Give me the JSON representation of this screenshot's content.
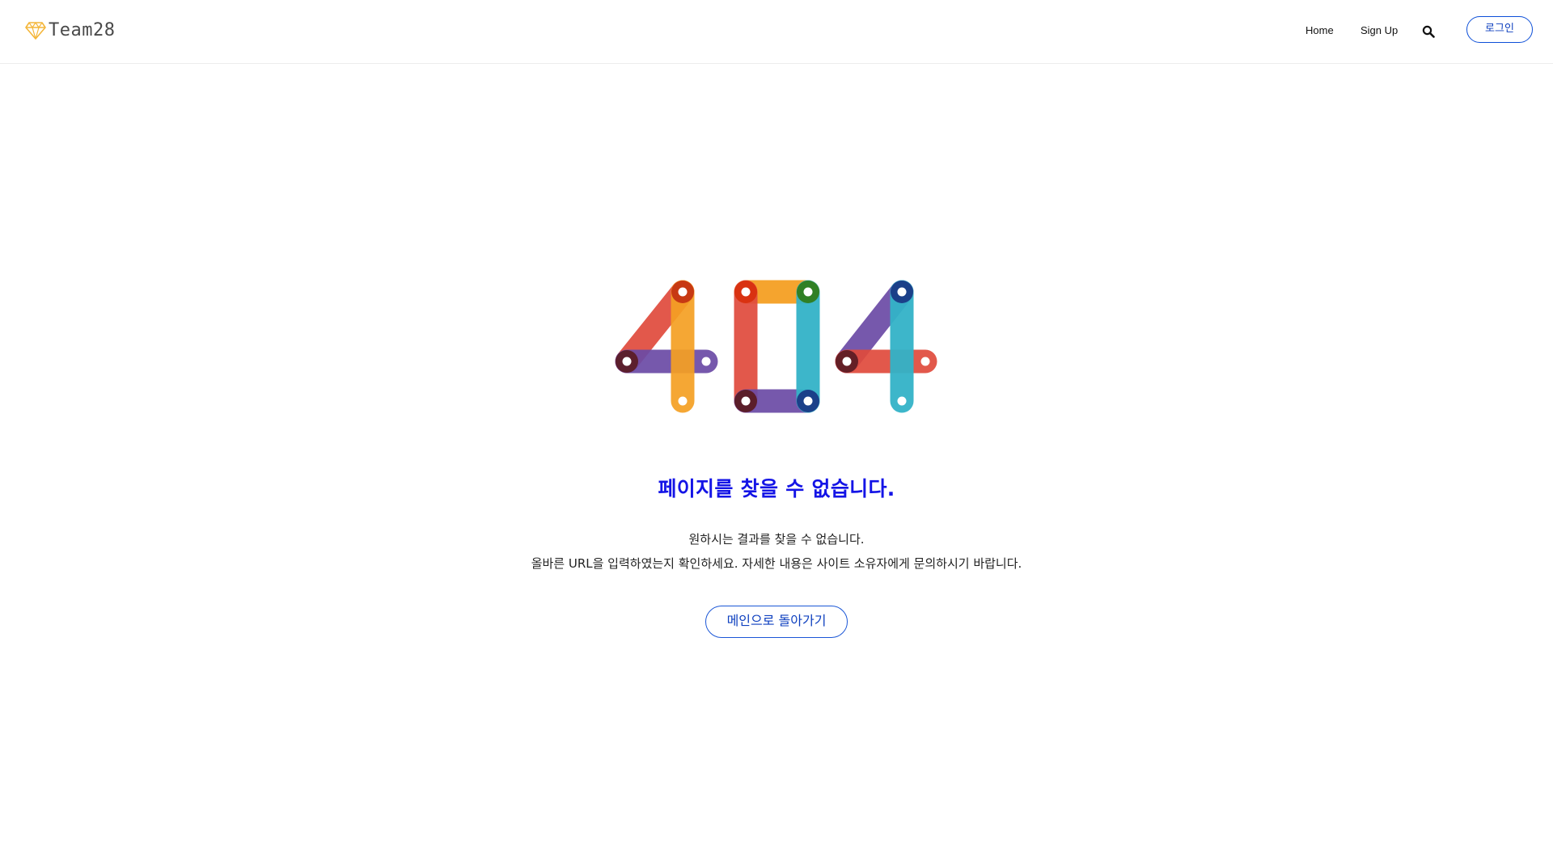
{
  "header": {
    "logo_text": "Team28",
    "nav": {
      "home": "Home",
      "signup": "Sign Up"
    },
    "search_icon": "search-icon",
    "login_label": "로그인"
  },
  "main": {
    "error_graphic": "404",
    "title": "페이지를 찾을 수 없습니다.",
    "description_line1": "원하시는 결과를 찾을 수 없습니다.",
    "description_line2": "올바른 URL을 입력하였는지 확인하세요. 자세한 내용은 사이트 소유자에게 문의하시기 바랍니다.",
    "back_button_label": "메인으로 돌아가기"
  },
  "colors": {
    "accent_blue": "#1414e6",
    "button_border": "#1a56d6",
    "logo_gem": "#f4b63a",
    "digit_red": "#e04a3c",
    "digit_orange": "#f5a023",
    "digit_purple": "#6b4aa6",
    "digit_teal": "#33b3c8",
    "digit_green": "#2f7d1c",
    "digit_navy": "#1a3a86"
  }
}
